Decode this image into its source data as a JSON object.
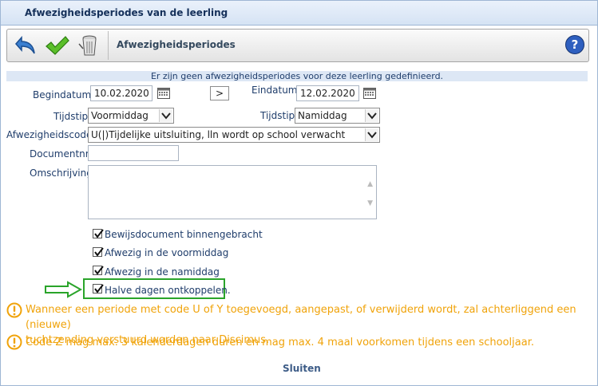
{
  "window": {
    "title": "Afwezigheidsperiodes van de leerling"
  },
  "toolbar": {
    "title": "Afwezigheidsperiodes"
  },
  "info": "Er zijn geen afwezigheidsperiodes voor deze leerling gedefinieerd.",
  "form": {
    "begindatum_label": "Begindatum",
    "begindatum_value": "10.02.2020",
    "shift_button": ">",
    "einddatum_label": "Eindatum",
    "einddatum_value": "12.02.2020",
    "tijdstip_label": "Tijdstip",
    "tijdstip_begin_value": "Voormiddag",
    "tijdstip_eind_label": "Tijdstip",
    "tijdstip_eind_value": "Namiddag",
    "code_label": "Afwezigheidscode",
    "code_value": "U(|)Tijdelijke uitsluiting, lln wordt op school verwacht",
    "documentnr_label": "Documentnr.",
    "documentnr_value": "",
    "omschrijving_label": "Omschrijving",
    "omschrijving_value": ""
  },
  "checkboxes": [
    {
      "label": "Bewijsdocument binnengebracht",
      "checked": true
    },
    {
      "label": "Afwezig in de voormiddag",
      "checked": true
    },
    {
      "label": "Afwezig in de namiddag",
      "checked": true
    },
    {
      "label": "Halve dagen ontkoppelen.",
      "checked": true
    }
  ],
  "warnings": [
    {
      "line1": "Wanneer een periode met code U of Y toegevoegd, aangepast, of verwijderd wordt, zal achterliggend een (nieuwe)",
      "line2": "tuchtzending verstuurd worden naar Discimus."
    },
    {
      "line1": "Code Z mag max. 3 kalenderdagen duren en mag max. 4 maal voorkomen tijdens een schooljaar."
    }
  ],
  "footer": {
    "close_label": "Sluiten"
  },
  "colors": {
    "accent": "#1f3d6b",
    "warning": "#f0a30a",
    "highlight": "#2aa42a"
  }
}
